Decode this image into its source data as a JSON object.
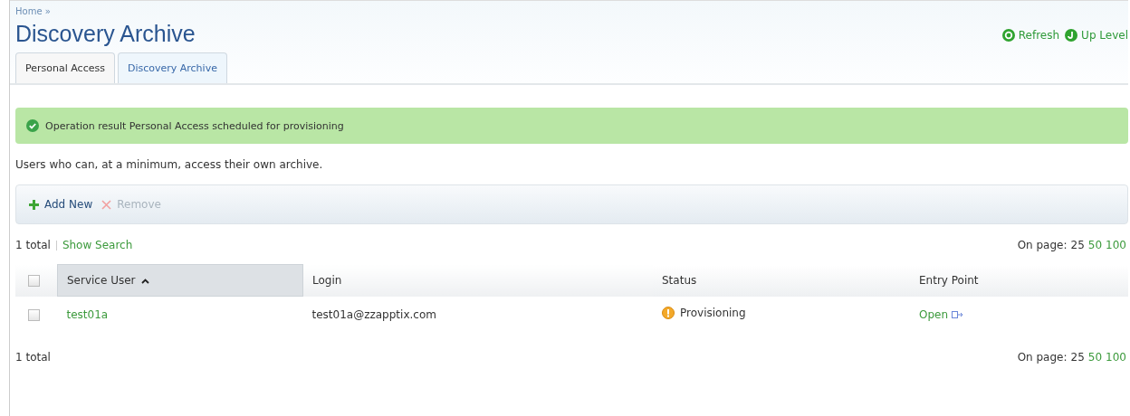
{
  "breadcrumb": [
    {
      "label": "Home",
      "separator": "»"
    }
  ],
  "title": "Discovery Archive",
  "header_actions": [
    {
      "label": "Refresh",
      "kind": "refresh"
    },
    {
      "label": "Up Level",
      "kind": "up"
    }
  ],
  "tabs": [
    {
      "label": "Personal Access",
      "selected": true
    },
    {
      "label": "Discovery Archive",
      "selected": false
    }
  ],
  "message": {
    "kind": "success",
    "text": "Operation result Personal Access scheduled for provisioning"
  },
  "description": "Users who can, at a minimum, access their own archive.",
  "toolbar": [
    {
      "label": "Add New",
      "kind": "add",
      "disabled": false
    },
    {
      "label": "Remove",
      "kind": "remove",
      "disabled": true
    }
  ],
  "top_pager": {
    "total": "1 total",
    "search_link": "Show Search",
    "label": "On page:",
    "sizes": [
      {
        "label": "25",
        "selected": true
      },
      {
        "label": "50",
        "selected": false
      },
      {
        "label": "100",
        "selected": false
      }
    ]
  },
  "table": {
    "select_all_checked": false,
    "columns": [
      {
        "label": "Service User",
        "sorted": true
      },
      {
        "label": "Login",
        "sorted": false
      },
      {
        "label": "Status",
        "sorted": false
      },
      {
        "label": "Entry Point",
        "sorted": false
      }
    ],
    "rows": [
      {
        "checked": false,
        "service_user": "test01a",
        "login": "test01a@zzapptix.com",
        "status": {
          "text": "Provisioning",
          "kind": "warning"
        },
        "entry_point": "Open"
      }
    ]
  },
  "bottom_pager": {
    "total": "1 total",
    "label": "On page:",
    "sizes": [
      {
        "label": "25",
        "selected": true
      },
      {
        "label": "50",
        "selected": false
      },
      {
        "label": "100",
        "selected": false
      }
    ]
  }
}
